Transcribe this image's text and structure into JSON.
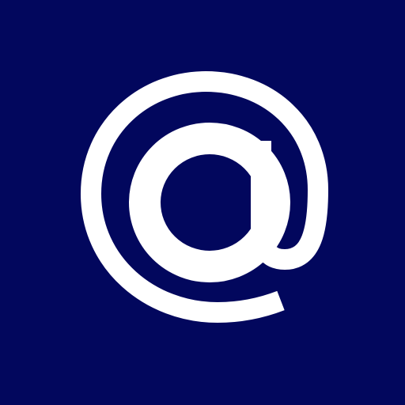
{
  "app_icon": {
    "icon": "at-sign-icon",
    "background_color": "#02075d",
    "glyph_color": "#ffffff"
  }
}
